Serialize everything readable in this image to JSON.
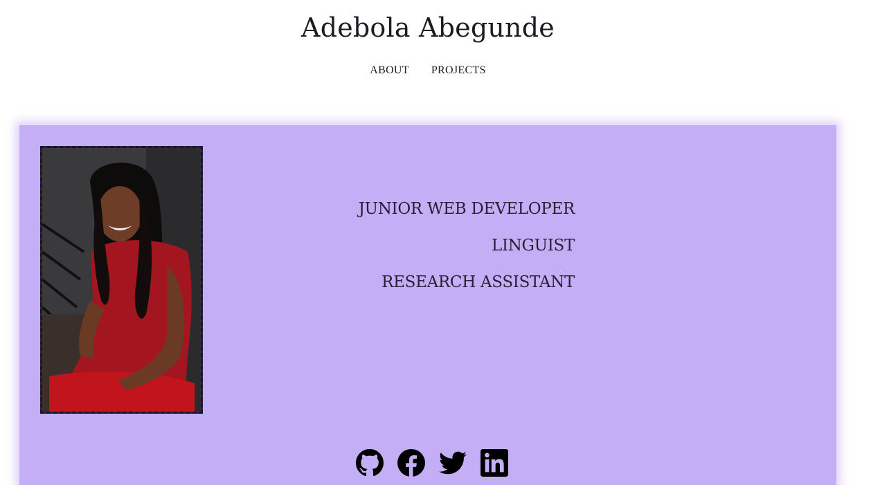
{
  "header": {
    "title": "Adebola Abegunde",
    "nav": [
      {
        "label": "ABOUT"
      },
      {
        "label": "PROJECTS"
      }
    ]
  },
  "hero": {
    "portrait_alt": "portrait-photo",
    "roles": [
      "JUNIOR WEB DEVELOPER",
      "LINGUIST",
      "RESEARCH ASSISTANT"
    ],
    "background_color": "#c4aef5",
    "socials": [
      {
        "icon": "github-icon"
      },
      {
        "icon": "facebook-icon"
      },
      {
        "icon": "twitter-icon"
      },
      {
        "icon": "linkedin-icon"
      }
    ]
  }
}
